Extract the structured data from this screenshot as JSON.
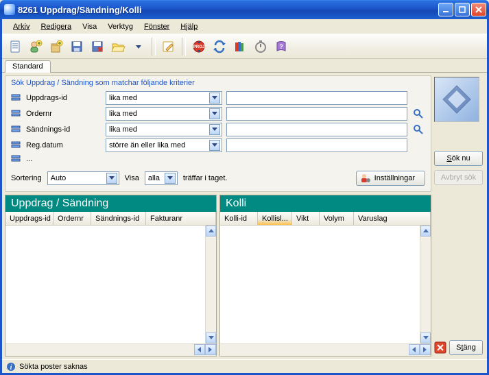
{
  "window": {
    "title": "8261 Uppdrag/Sändning/Kolli"
  },
  "menu": {
    "arkiv": "Arkiv",
    "redigera": "Redigera",
    "visa": "Visa",
    "verktyg": "Verktyg",
    "fonster": "Fönster",
    "hjalp": "Hjälp"
  },
  "tabs": {
    "standard": "Standard"
  },
  "search": {
    "title": "Sök Uppdrag / Sändning som matchar följande kriterier",
    "rows": [
      {
        "label": "Uppdrags-id",
        "op": "lika med",
        "value": ""
      },
      {
        "label": "Ordernr",
        "op": "lika med",
        "value": ""
      },
      {
        "label": "Sändnings-id",
        "op": "lika med",
        "value": ""
      },
      {
        "label": "Reg.datum",
        "op": "större än eller lika med",
        "value": ""
      }
    ],
    "more": "...",
    "sortering_label": "Sortering",
    "sortering_value": "Auto",
    "visa_label": "Visa",
    "visa_value": "alla",
    "visa_suffix": "träffar i taget.",
    "settings_label": "Inställningar"
  },
  "panels": {
    "left": {
      "title": "Uppdrag / Sändning",
      "cols": [
        "Uppdrags-id",
        "Ordernr",
        "Sändnings-id",
        "Fakturanr"
      ]
    },
    "right": {
      "title": "Kolli",
      "cols": [
        "Kolli-id",
        "Kollisl...",
        "Vikt",
        "Volym",
        "Varuslag"
      ],
      "active_col": 1
    }
  },
  "side": {
    "sok": "Sök nu",
    "avbryt": "Avbryt sök",
    "stang": "Stäng"
  },
  "status": {
    "text": "Sökta poster saknas"
  },
  "chart_data": {
    "type": "table",
    "rows": []
  }
}
